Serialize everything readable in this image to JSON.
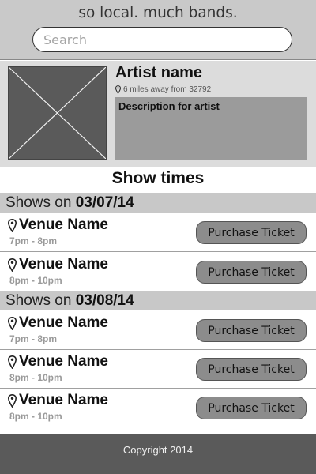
{
  "header": {
    "title": "so local. much bands.",
    "search_placeholder": "Search",
    "search_value": ""
  },
  "artist": {
    "name": "Artist name",
    "distance": "6 miles away from 32792",
    "description": "Description for artist",
    "photo_icon": "image-placeholder-icon"
  },
  "shows": {
    "heading": "Show times",
    "day1": {
      "prefix": "Shows on ",
      "date": "03/07/14",
      "rows": [
        {
          "venue": "Venue Name",
          "time": "7pm - 8pm",
          "button": "Purchase Ticket"
        },
        {
          "venue": "Venue Name",
          "time": "8pm - 10pm",
          "button": "Purchase Ticket"
        }
      ]
    },
    "day2": {
      "prefix": "Shows on ",
      "date": "03/08/14",
      "rows": [
        {
          "venue": "Venue Name",
          "time": "7pm - 8pm",
          "button": "Purchase Ticket"
        },
        {
          "venue": "Venue Name",
          "time": "8pm - 10pm",
          "button": "Purchase Ticket"
        },
        {
          "venue": "Venue Name",
          "time": "8pm - 10pm",
          "button": "Purchase Ticket"
        }
      ]
    }
  },
  "footer": {
    "copyright": "Copyright 2014"
  },
  "colors": {
    "header_bg": "#c9c9c9",
    "panel_bg": "#dcdcdc",
    "date_bar_bg": "#c8c8c8",
    "button_bg": "#8c8c8c",
    "footer_bg": "#5a5a5a"
  },
  "icons": {
    "location": "map-pin-icon"
  }
}
